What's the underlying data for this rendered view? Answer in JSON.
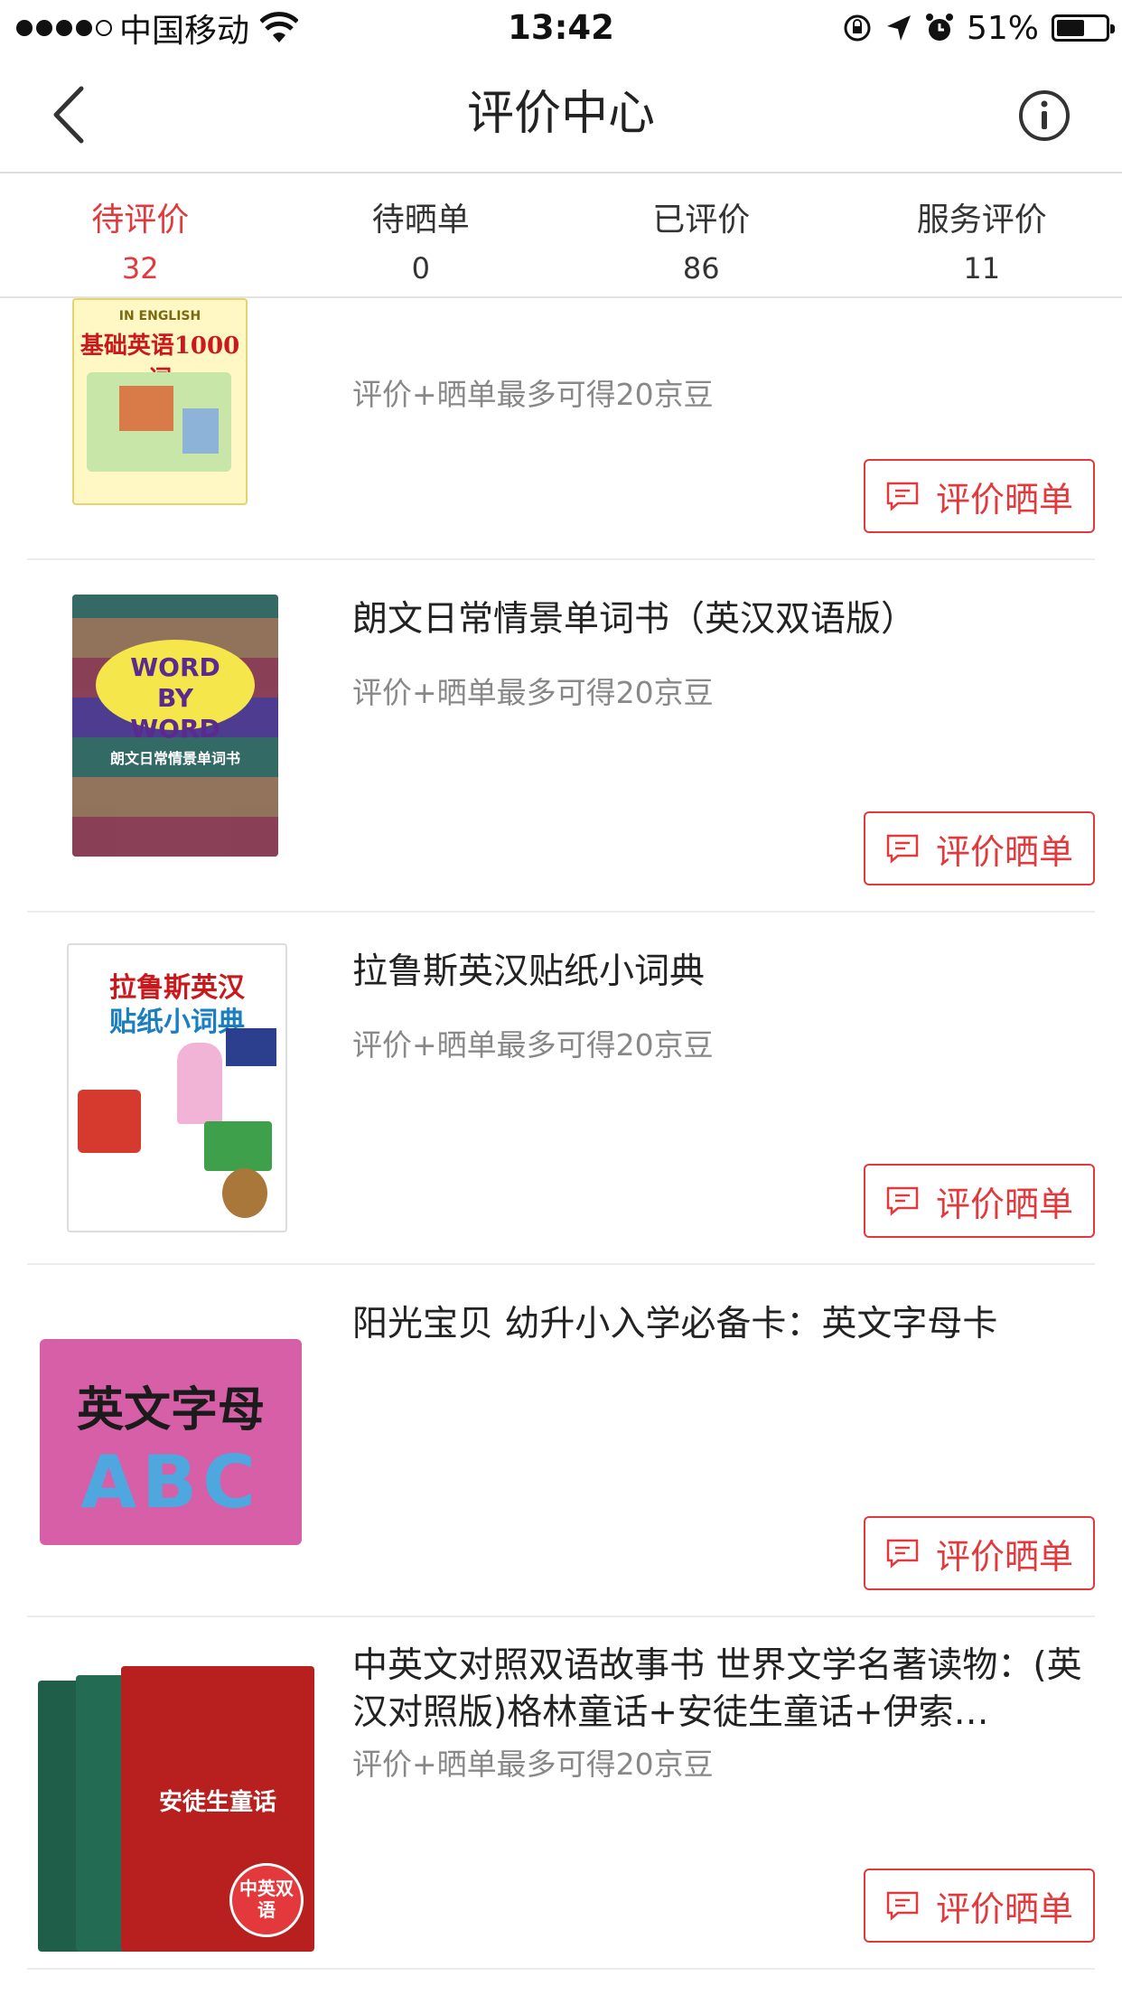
{
  "status_bar": {
    "carrier": "中国移动",
    "time": "13:42",
    "battery": "51%",
    "battery_level": 0.51
  },
  "nav": {
    "title": "评价中心"
  },
  "tabs": [
    {
      "label": "待评价",
      "count": "32"
    },
    {
      "label": "待晒单",
      "count": "0"
    },
    {
      "label": "已评价",
      "count": "86"
    },
    {
      "label": "服务评价",
      "count": "11"
    }
  ],
  "items": [
    {
      "title": "",
      "subtitle": "评价+晒单最多可得20京豆",
      "button": "评价晒单",
      "cover_text": "基础英语1000词",
      "cover_sub": "IN ENGLISH"
    },
    {
      "title": "朗文日常情景单词书（英汉双语版）",
      "subtitle": "评价+晒单最多可得20京豆",
      "button": "评价晒单",
      "cover_text": "WORD BY WORD",
      "cover_sub": "朗文日常情景单词书"
    },
    {
      "title": "拉鲁斯英汉贴纸小词典",
      "subtitle": "评价+晒单最多可得20京豆",
      "button": "评价晒单",
      "cover_text": "拉鲁斯英汉",
      "cover_sub": "贴纸小词典"
    },
    {
      "title": "阳光宝贝 幼升小入学必备卡：英文字母卡",
      "subtitle": "",
      "button": "评价晒单",
      "cover_text": "英文字母",
      "cover_sub": "ABC"
    },
    {
      "title": "中英文对照双语故事书 世界文学名著读物：(英汉对照版)格林童话+安徒生童话+伊索…",
      "subtitle": "评价+晒单最多可得20京豆",
      "button": "评价晒单",
      "cover_text": "安徒生童话",
      "cover_sub": "中英双语"
    }
  ],
  "colors": {
    "accent": "#e4393c",
    "text": "#222222",
    "muted": "#888888",
    "divider": "#ececec"
  }
}
